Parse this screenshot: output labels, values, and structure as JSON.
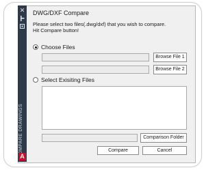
{
  "sidebar": {
    "close_icon": "✕",
    "pin_icon": "pin-icon",
    "settings_icon": "settings-icon",
    "vertical_label": "COMPARE DRAWINGS",
    "logo_letter": "A"
  },
  "dialog": {
    "title": "DWG/DXF Compare",
    "instruction_line1": "Please select two files(.dwg/dxf) that you wish to compare.",
    "instruction_line2": "Hit Compare button!",
    "option_choose_files": "Choose Files",
    "option_choose_files_selected": true,
    "browse_file_1": "Browse File 1",
    "browse_file_2": "Browse File 2",
    "option_existing_files": "Select Exisiting Files",
    "comparison_folder": "Comparison Folder",
    "compare_button": "Compare",
    "cancel_button": "Cancel",
    "file1_value": "",
    "file2_value": "",
    "folder_value": ""
  },
  "colors": {
    "sidebar_bg": "#2f3a49",
    "window_bg": "#f0f0f0",
    "logo_red": "#c8102e"
  }
}
